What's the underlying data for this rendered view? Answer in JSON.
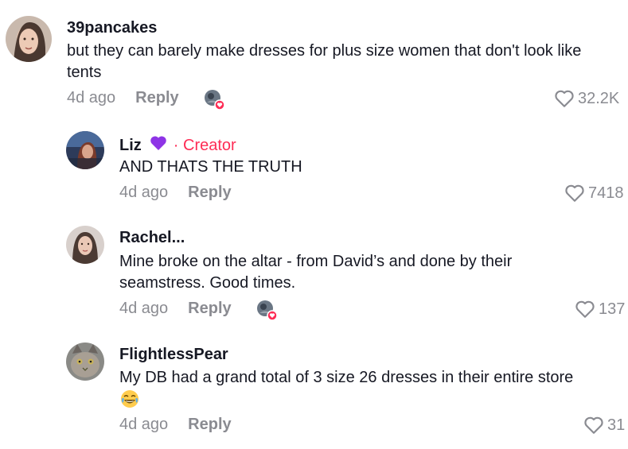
{
  "comments": [
    {
      "username": "39pancakes",
      "text": "but they can barely make dresses for plus size women that don't look like tents",
      "time": "4d ago",
      "reply_label": "Reply",
      "likes": "32.2K",
      "liked_by_creator": true
    },
    {
      "username": "Liz",
      "badge": "· Creator",
      "text": "AND THATS THE TRUTH",
      "time": "4d ago",
      "reply_label": "Reply",
      "likes": "7418",
      "liked_by_creator": false
    },
    {
      "username": "Rachel...",
      "text": "Mine broke on the altar - from David’s and done by their seamstress. Good times.",
      "time": "4d ago",
      "reply_label": "Reply",
      "likes": "137",
      "liked_by_creator": true
    },
    {
      "username": "FlightlessPear",
      "text": "My DB had a grand total of 3 size 26 dresses in their entire store",
      "time": "4d ago",
      "reply_label": "Reply",
      "likes": "31",
      "liked_by_creator": false
    }
  ],
  "colors": {
    "creator": "#fe2c55",
    "meta": "#8a8b91",
    "text": "#161823"
  },
  "icons": [
    "heart-outline-icon",
    "purple-heart-emoji-icon",
    "laughing-emoji-icon",
    "creator-liked-badge-icon"
  ]
}
